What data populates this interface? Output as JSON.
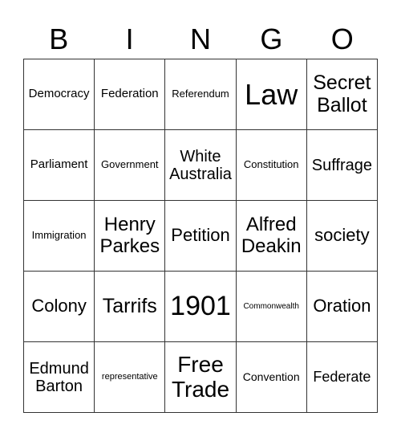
{
  "header": {
    "letters": [
      "B",
      "I",
      "N",
      "G",
      "O"
    ]
  },
  "cells": [
    [
      "Democracy",
      "Federation",
      "Referendum",
      "Law",
      "Secret Ballot"
    ],
    [
      "Parliament",
      "Government",
      "White Australia",
      "Constitution",
      "Suffrage"
    ],
    [
      "Immigration",
      "Henry Parkes",
      "Petition",
      "Alfred Deakin",
      "society"
    ],
    [
      "Colony",
      "Tarrifs",
      "1901",
      "Commonwealth",
      "Oration"
    ],
    [
      "Edmund Barton",
      "representative",
      "Free Trade",
      "Convention",
      "Federate"
    ]
  ]
}
